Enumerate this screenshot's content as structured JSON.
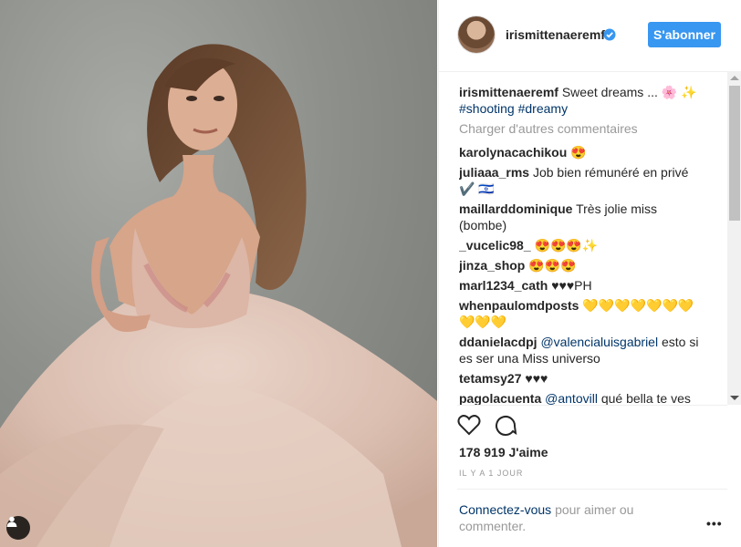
{
  "post": {
    "username": "irismittenaeremf",
    "follow_label": "S'abonner",
    "caption_user": "irismittenaeremf",
    "caption_text": "Sweet dreams ... 🌸 ✨",
    "caption_tags": [
      "#shooting",
      "#dreamy"
    ],
    "load_more": "Charger d'autres commentaires",
    "likes": "178 919 J'aime",
    "time": "IL Y A 1 JOUR",
    "login_link": "Connectez-vous",
    "login_text": "pour aimer ou commenter.",
    "more_label": "•••"
  },
  "comments": [
    {
      "user": "karolynacachikou",
      "text": "😍"
    },
    {
      "user": "juliaaa_rms",
      "text": "Job bien rémunéré en privé ✔️ 🇮🇱"
    },
    {
      "user": "maillarddominique",
      "text": "Très jolie miss (bombe)"
    },
    {
      "user": "_vucelic98_",
      "text": "😍😍😍✨"
    },
    {
      "user": "jinza_shop",
      "text": "😍😍😍"
    },
    {
      "user": "marl1234_cath",
      "text": "♥♥♥PH"
    },
    {
      "user": "whenpaulomdposts",
      "text": "💛💛💛💛💛💛💛💛💛💛"
    },
    {
      "user": "ddanielacdpj",
      "mention": "@valencialuisgabriel",
      "text": "esto si es ser una Miss universo"
    },
    {
      "user": "tetamsy27",
      "text": "♥♥♥"
    },
    {
      "user": "pagolacuenta",
      "mention": "@antovill",
      "text": "qué bella te ves"
    }
  ],
  "icons": [
    "verified-badge-icon",
    "heart-icon",
    "comment-icon",
    "user-tag-icon"
  ]
}
